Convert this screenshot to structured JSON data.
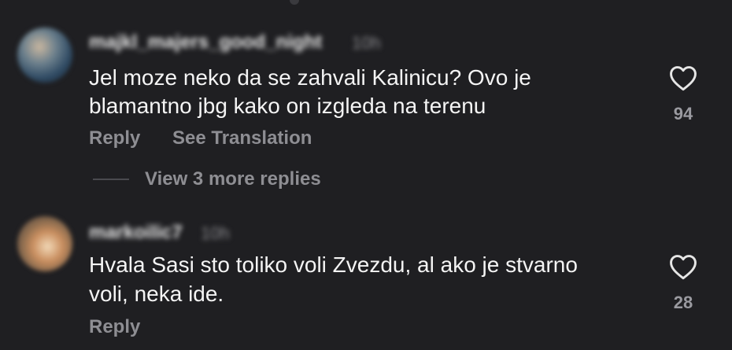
{
  "comments": [
    {
      "username": "majkl_majers_good_night",
      "time": "10h",
      "lines": [
        "Jel moze neko da se zahvali Kalinicu? Ovo je",
        "blamantno jbg kako on izgleda na terenu"
      ],
      "likes": "94",
      "reply_label": "Reply",
      "translate_label": "See Translation"
    },
    {
      "username": "markoilic7",
      "time": "10h",
      "lines": [
        "Hvala Sasi sto toliko voli Zvezdu, al ako je stvarno",
        "voli, neka ide."
      ],
      "likes": "28",
      "reply_label": "Reply"
    }
  ],
  "view_more_replies": "View 3 more replies",
  "icons": {
    "like": "heart-outline-icon"
  },
  "colors": {
    "background": "#1f1f22",
    "primary_text": "#f4f4f4",
    "secondary_text": "#8e8e93"
  }
}
